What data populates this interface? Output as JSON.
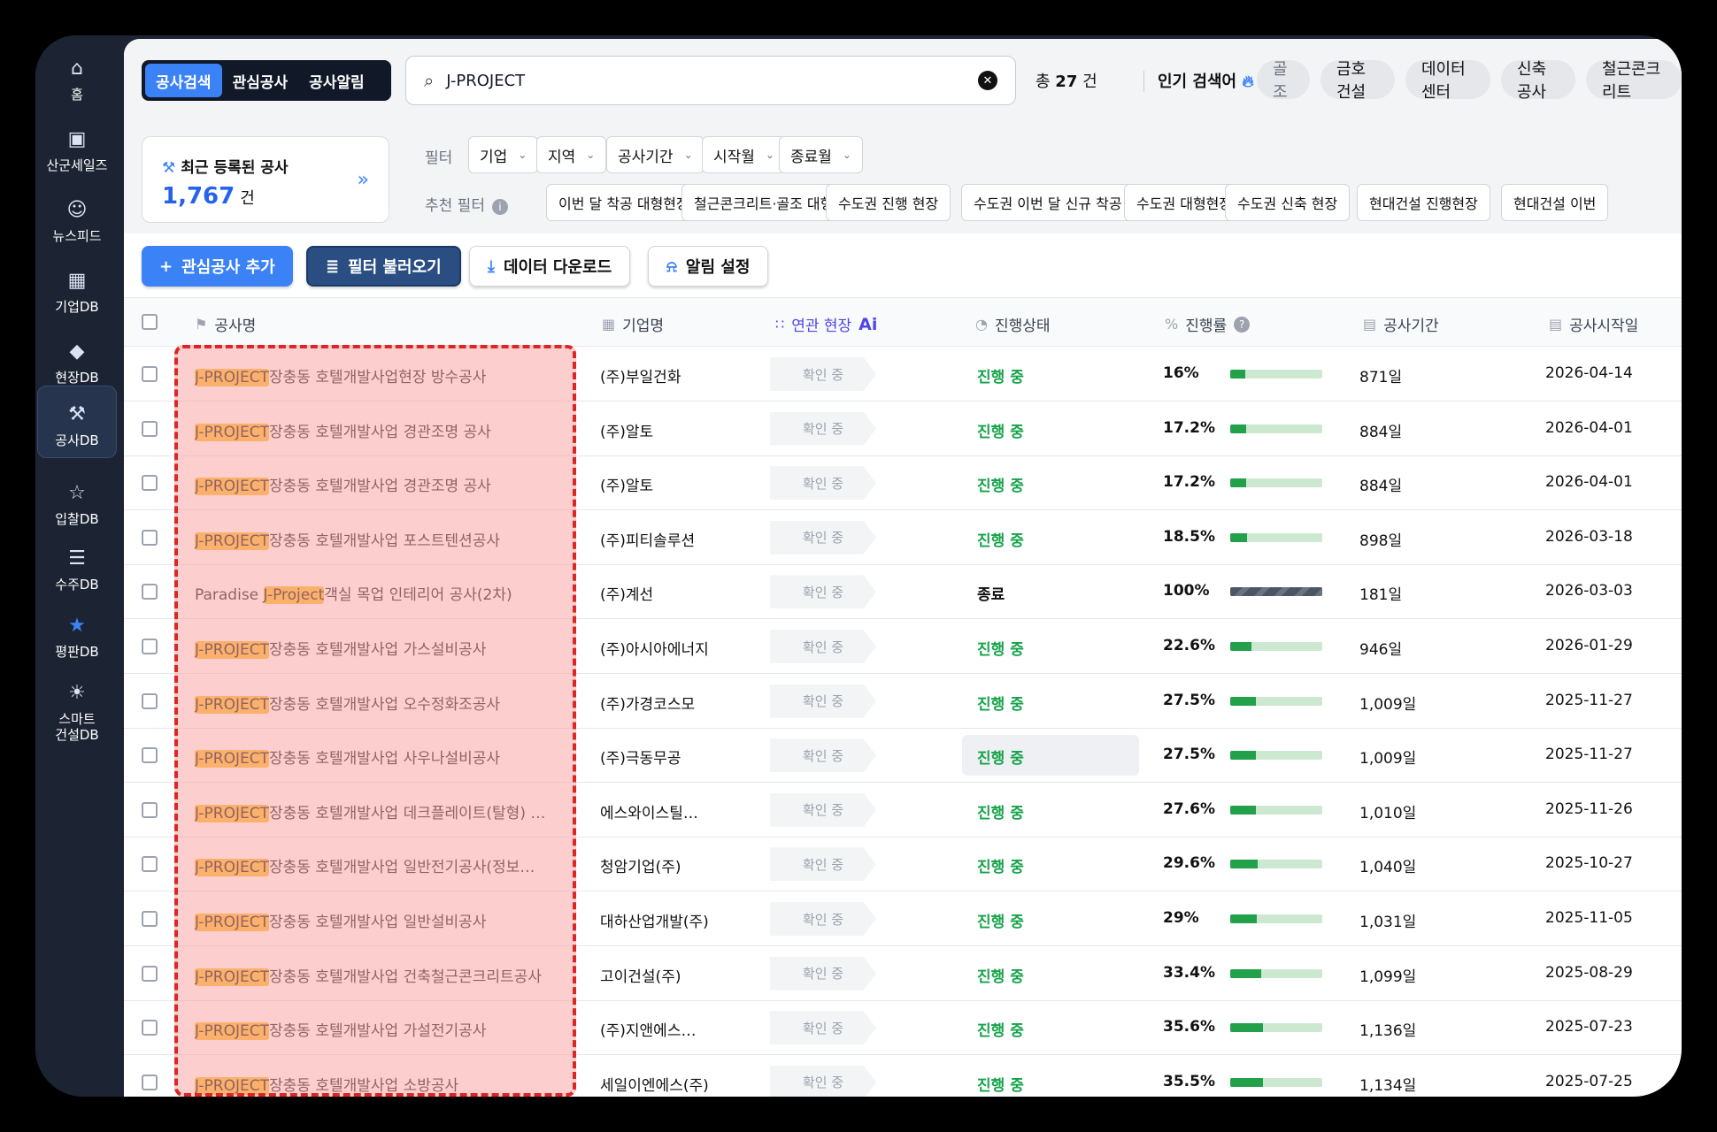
{
  "sidebar": {
    "items": [
      {
        "label": "홈",
        "icon": "home-icon"
      },
      {
        "label": "산군세일즈",
        "icon": "briefcase-icon"
      },
      {
        "label": "뉴스피드",
        "icon": "news-reader-icon"
      },
      {
        "label": "기업DB",
        "icon": "building-icon"
      },
      {
        "label": "현장DB",
        "icon": "site-map-icon"
      },
      {
        "label": "공사DB",
        "icon": "tools-icon"
      },
      {
        "label": "입찰DB",
        "icon": "trophy-icon"
      },
      {
        "label": "수주DB",
        "icon": "document-icon"
      },
      {
        "label": "평판DB",
        "icon": "star-badge-icon"
      },
      {
        "label": "스마트\n건설DB",
        "icon": "lightbulb-icon"
      }
    ],
    "active_index": 5
  },
  "topbar": {
    "tabs": [
      "공사검색",
      "관심공사",
      "공사알림"
    ],
    "active_tab": "공사검색",
    "search_value": "J-PROJECT",
    "total_prefix": "총",
    "total_count": "27",
    "total_unit": "건",
    "popular_label": "인기 검색어",
    "popular": [
      "골조",
      "금호건설",
      "데이터센터",
      "신축공사",
      "철근콘크리트"
    ]
  },
  "recent": {
    "title": "최근 등록된 공사",
    "count": "1,767",
    "unit": "건"
  },
  "filters": {
    "label": "필터",
    "dropdowns": [
      "기업",
      "지역",
      "공사기간",
      "시작월",
      "종료월"
    ],
    "recommended_label": "추천 필터",
    "recommended": [
      "이번 달 착공 대형현장",
      "철근콘크리트·골조 대형",
      "수도권 진행 현장",
      "수도권 이번 달 신규 착공",
      "수도권 대형현장",
      "수도권 신축 현장",
      "현대건설 진행현장",
      "현대건설 이번"
    ]
  },
  "actions": {
    "add": "관심공사 추가",
    "load_filter": "필터 불러오기",
    "download": "데이터 다운로드",
    "alert": "알림 설정"
  },
  "table": {
    "headers": {
      "name": "공사명",
      "company": "기업명",
      "related": "연관 현장",
      "related_ai": "Ai",
      "status": "진행상태",
      "progress": "진행률",
      "period": "공사기간",
      "start": "공사시작일"
    },
    "rows": [
      {
        "prefix": "",
        "hl": "J-PROJECT",
        "rest": "장충동 호텔개발사업현장 방수공사",
        "company": "(주)부일건화",
        "related": "확인 중",
        "status": "진행 중",
        "status_type": "on",
        "progress_label": "16%",
        "progress": 0.16,
        "period": "871일",
        "start": "2026-04-14"
      },
      {
        "prefix": "",
        "hl": "J-PROJECT",
        "rest": "장충동 호텔개발사업 경관조명 공사",
        "company": "(주)알토",
        "related": "확인 중",
        "status": "진행 중",
        "status_type": "on",
        "progress_label": "17.2%",
        "progress": 0.172,
        "period": "884일",
        "start": "2026-04-01"
      },
      {
        "prefix": "",
        "hl": "J-PROJECT",
        "rest": "장충동 호텔개발사업 경관조명 공사",
        "company": "(주)알토",
        "related": "확인 중",
        "status": "진행 중",
        "status_type": "on",
        "progress_label": "17.2%",
        "progress": 0.172,
        "period": "884일",
        "start": "2026-04-01"
      },
      {
        "prefix": "",
        "hl": "J-PROJECT",
        "rest": "장충동 호텔개발사업 포스트텐션공사",
        "company": "(주)피티솔루션",
        "related": "확인 중",
        "status": "진행 중",
        "status_type": "on",
        "progress_label": "18.5%",
        "progress": 0.185,
        "period": "898일",
        "start": "2026-03-18"
      },
      {
        "prefix": "Paradise ",
        "hl": "J-Project",
        "rest": "객실 목업 인테리어 공사(2차)",
        "company": "(주)계선",
        "related": "확인 중",
        "status": "종료",
        "status_type": "done",
        "progress_label": "100%",
        "progress": 1.0,
        "period": "181일",
        "start": "2026-03-03"
      },
      {
        "prefix": "",
        "hl": "J-PROJECT",
        "rest": "장충동 호텔개발사업 가스설비공사",
        "company": "(주)아시아에너지",
        "related": "확인 중",
        "status": "진행 중",
        "status_type": "on",
        "progress_label": "22.6%",
        "progress": 0.226,
        "period": "946일",
        "start": "2026-01-29"
      },
      {
        "prefix": "",
        "hl": "J-PROJECT",
        "rest": "장충동 호텔개발사업 오수정화조공사",
        "company": "(주)가경코스모",
        "related": "확인 중",
        "status": "진행 중",
        "status_type": "on",
        "progress_label": "27.5%",
        "progress": 0.275,
        "period": "1,009일",
        "start": "2025-11-27"
      },
      {
        "prefix": "",
        "hl": "J-PROJECT",
        "rest": "장충동 호텔개발사업 사우나설비공사",
        "company": "(주)극동무공",
        "related": "확인 중",
        "status": "진행 중",
        "status_type": "on",
        "progress_label": "27.5%",
        "progress": 0.275,
        "period": "1,009일",
        "start": "2025-11-27",
        "hover": true
      },
      {
        "prefix": "",
        "hl": "J-PROJECT",
        "rest": "장충동 호텔개발사업 데크플레이트(탈형) …",
        "company": "에스와이스틸…",
        "related": "확인 중",
        "status": "진행 중",
        "status_type": "on",
        "progress_label": "27.6%",
        "progress": 0.276,
        "period": "1,010일",
        "start": "2025-11-26"
      },
      {
        "prefix": "",
        "hl": "J-PROJECT",
        "rest": "장충동 호텔개발사업 일반전기공사(정보…",
        "company": "청암기업(주)",
        "related": "확인 중",
        "status": "진행 중",
        "status_type": "on",
        "progress_label": "29.6%",
        "progress": 0.296,
        "period": "1,040일",
        "start": "2025-10-27"
      },
      {
        "prefix": "",
        "hl": "J-PROJECT",
        "rest": "장충동 호텔개발사업 일반설비공사",
        "company": "대하산업개발(주)",
        "related": "확인 중",
        "status": "진행 중",
        "status_type": "on",
        "progress_label": "29%",
        "progress": 0.29,
        "period": "1,031일",
        "start": "2025-11-05"
      },
      {
        "prefix": "",
        "hl": "J-PROJECT",
        "rest": "장충동 호텔개발사업 건축철근콘크리트공사",
        "company": "고이건설(주)",
        "related": "확인 중",
        "status": "진행 중",
        "status_type": "on",
        "progress_label": "33.4%",
        "progress": 0.334,
        "period": "1,099일",
        "start": "2025-08-29"
      },
      {
        "prefix": "",
        "hl": "J-PROJECT",
        "rest": "장충동 호텔개발사업 가설전기공사",
        "company": "(주)지앤에스…",
        "related": "확인 중",
        "status": "진행 중",
        "status_type": "on",
        "progress_label": "35.6%",
        "progress": 0.356,
        "period": "1,136일",
        "start": "2025-07-23"
      },
      {
        "prefix": "",
        "hl": "J-PROJECT",
        "rest": "장충동 호텔개발사업 소방공사",
        "company": "세일이엔에스(주)",
        "related": "확인 중",
        "status": "진행 중",
        "status_type": "on",
        "progress_label": "35.5%",
        "progress": 0.355,
        "period": "1,134일",
        "start": "2025-07-25"
      }
    ]
  },
  "colors": {
    "accent": "#3b82f6",
    "status_on": "#16a34a",
    "highlight": "#fbbf24",
    "overlay": "#dc2626"
  }
}
